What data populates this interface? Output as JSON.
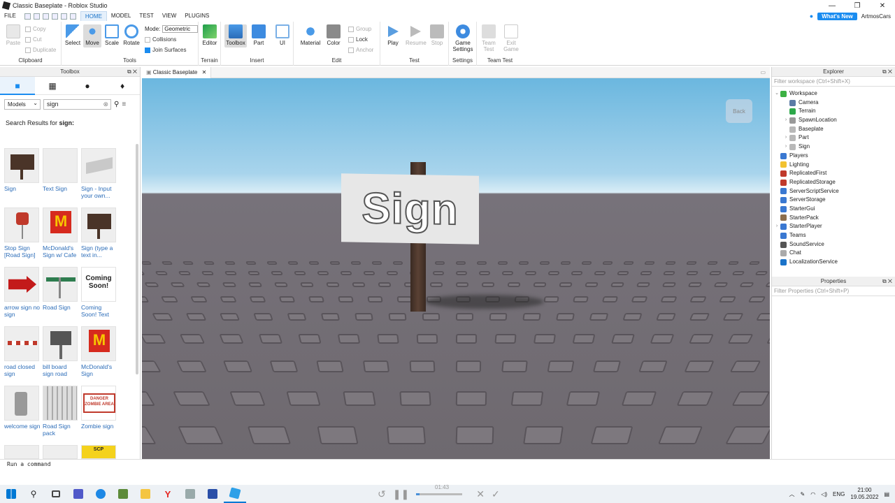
{
  "window": {
    "title": "Classic Baseplate - Roblox Studio"
  },
  "menu": {
    "items": [
      "FILE",
      "HOME",
      "MODEL",
      "TEST",
      "VIEW",
      "PLUGINS"
    ],
    "active": "HOME",
    "whats_new": "What's New",
    "user": "ArtmosCars"
  },
  "ribbon": {
    "clipboard": {
      "paste": "Paste",
      "copy": "Copy",
      "cut": "Cut",
      "duplicate": "Duplicate",
      "label": "Clipboard"
    },
    "tools": {
      "select": "Select",
      "move": "Move",
      "scale": "Scale",
      "rotate": "Rotate",
      "mode_label": "Mode:",
      "mode_value": "Geometric",
      "collisions": "Collisions",
      "join_surfaces": "Join Surfaces",
      "label": "Tools"
    },
    "terrain": {
      "editor": "Editor",
      "label": "Terrain"
    },
    "insert": {
      "toolbox": "Toolbox",
      "part": "Part",
      "ui": "UI",
      "label": "Insert"
    },
    "edit": {
      "material": "Material",
      "color": "Color",
      "group": "Group",
      "lock": "Lock",
      "anchor": "Anchor",
      "label": "Edit"
    },
    "test": {
      "play": "Play",
      "resume": "Resume",
      "stop": "Stop",
      "label": "Test"
    },
    "settings": {
      "game_settings": "Game Settings",
      "label": "Settings"
    },
    "team_test": {
      "team_test": "Team Test",
      "exit_game": "Exit Game",
      "label": "Team Test"
    }
  },
  "toolbox": {
    "title": "Toolbox",
    "category": "Models",
    "search_value": "sign",
    "results_prefix": "Search Results for",
    "results_term": "sign:",
    "items": [
      "Sign",
      "Text Sign",
      "Sign - Input your own...",
      "Stop Sign [Road Sign]",
      "McDonald's Sign w/ Cafe",
      "Sign (type a text in...",
      "arrow sign no sign",
      "Road Sign",
      "Coming Soon! Text",
      "road closed sign",
      "bill board sign road",
      "McDonald's Sign",
      "welcome sign",
      "Road Sign pack",
      "Zombie sign"
    ],
    "thumb_text": {
      "coming": "Coming Soon!",
      "danger": "DANGER ZOMBIE AREA",
      "scp": "SCP"
    }
  },
  "viewport": {
    "tab": "Classic Baseplate",
    "sign_text": "Sign",
    "back_label": "Back"
  },
  "explorer": {
    "title": "Explorer",
    "filter_placeholder": "Filter workspace (Ctrl+Shift+X)",
    "nodes": [
      {
        "label": "Workspace",
        "depth": 0,
        "arrow": "⌄",
        "color": "#3cb043"
      },
      {
        "label": "Camera",
        "depth": 1,
        "arrow": "",
        "color": "#5a7aa5"
      },
      {
        "label": "Terrain",
        "depth": 1,
        "arrow": "",
        "color": "#2da84a"
      },
      {
        "label": "SpawnLocation",
        "depth": 1,
        "arrow": "›",
        "color": "#999999"
      },
      {
        "label": "Baseplate",
        "depth": 1,
        "arrow": "",
        "color": "#b8b8b8"
      },
      {
        "label": "Part",
        "depth": 1,
        "arrow": "›",
        "color": "#b8b8b8"
      },
      {
        "label": "Sign",
        "depth": 1,
        "arrow": "›",
        "color": "#b8b8b8"
      },
      {
        "label": "Players",
        "depth": 0,
        "arrow": "",
        "color": "#3a78d1"
      },
      {
        "label": "Lighting",
        "depth": 0,
        "arrow": "",
        "color": "#f2c230"
      },
      {
        "label": "ReplicatedFirst",
        "depth": 0,
        "arrow": "",
        "color": "#c0392b"
      },
      {
        "label": "ReplicatedStorage",
        "depth": 0,
        "arrow": "",
        "color": "#c0392b"
      },
      {
        "label": "ServerScriptService",
        "depth": 0,
        "arrow": "",
        "color": "#3a78d1"
      },
      {
        "label": "ServerStorage",
        "depth": 0,
        "arrow": "",
        "color": "#3a78d1"
      },
      {
        "label": "StarterGui",
        "depth": 0,
        "arrow": "",
        "color": "#3a78d1"
      },
      {
        "label": "StarterPack",
        "depth": 0,
        "arrow": "",
        "color": "#8d6e4c"
      },
      {
        "label": "StarterPlayer",
        "depth": 0,
        "arrow": "›",
        "color": "#3a78d1"
      },
      {
        "label": "Teams",
        "depth": 0,
        "arrow": "",
        "color": "#3a78d1"
      },
      {
        "label": "SoundService",
        "depth": 0,
        "arrow": "",
        "color": "#555555"
      },
      {
        "label": "Chat",
        "depth": 0,
        "arrow": "",
        "color": "#aaaaaa"
      },
      {
        "label": "LocalizationService",
        "depth": 0,
        "arrow": "",
        "color": "#1a73c9"
      }
    ]
  },
  "properties": {
    "title": "Properties",
    "filter_placeholder": "Filter Properties (Ctrl+Shift+P)"
  },
  "command_bar": {
    "placeholder": "Run a command"
  },
  "taskbar": {
    "media_time": "01:43",
    "lang": "ENG",
    "time": "21:00",
    "date": "19.05.2022"
  },
  "colors": {
    "accent": "#1a8cf0",
    "sky": "#8cc7e6",
    "ground": "#716c72"
  }
}
